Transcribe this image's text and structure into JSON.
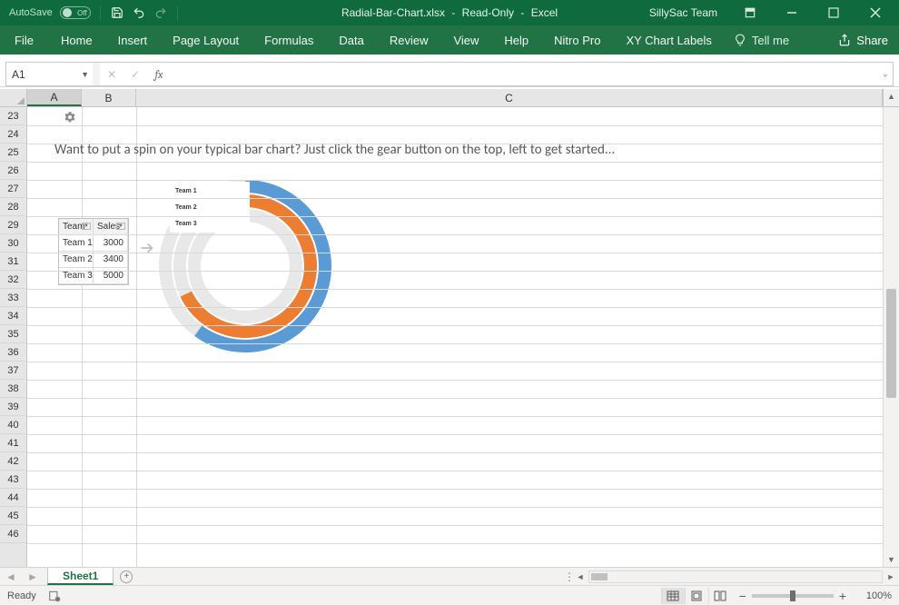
{
  "titlebar": {
    "autosave_label": "AutoSave",
    "autosave_state": "Off",
    "filename": "Radial-Bar-Chart.xlsx",
    "mode": "Read-Only",
    "app": "Excel",
    "team": "SillySac Team"
  },
  "ribbon": {
    "file": "File",
    "tabs": [
      "Home",
      "Insert",
      "Page Layout",
      "Formulas",
      "Data",
      "Review",
      "View",
      "Help",
      "Nitro Pro",
      "XY Chart Labels"
    ],
    "tellme": "Tell me",
    "share": "Share"
  },
  "formula": {
    "namebox": "A1",
    "fx_label": "fx",
    "value": ""
  },
  "grid": {
    "columns": [
      "A",
      "B",
      "C"
    ],
    "rows_start": 23,
    "rows_end": 46
  },
  "content": {
    "hint": "Want to put a spin on your typical bar chart? Just click the gear button on the top, left to get started...",
    "table": {
      "headers": [
        "Team",
        "Sales"
      ],
      "rows": [
        {
          "team": "Team 1",
          "sales": "3000"
        },
        {
          "team": "Team 2",
          "sales": "3400"
        },
        {
          "team": "Team 3",
          "sales": "5000"
        }
      ]
    }
  },
  "chart_data": {
    "type": "radial-bar",
    "categories": [
      "Team 1",
      "Team 2",
      "Team 3"
    ],
    "values": [
      3000,
      3400,
      5000
    ],
    "max": 5000,
    "colors": [
      "#5B9BD5",
      "#ED7D31",
      "#A5A5A5"
    ],
    "title": "",
    "legend_position": "top-left"
  },
  "sheetbar": {
    "active": "Sheet1",
    "add_sheet": "+"
  },
  "statusbar": {
    "status": "Ready",
    "zoom": "100%"
  }
}
